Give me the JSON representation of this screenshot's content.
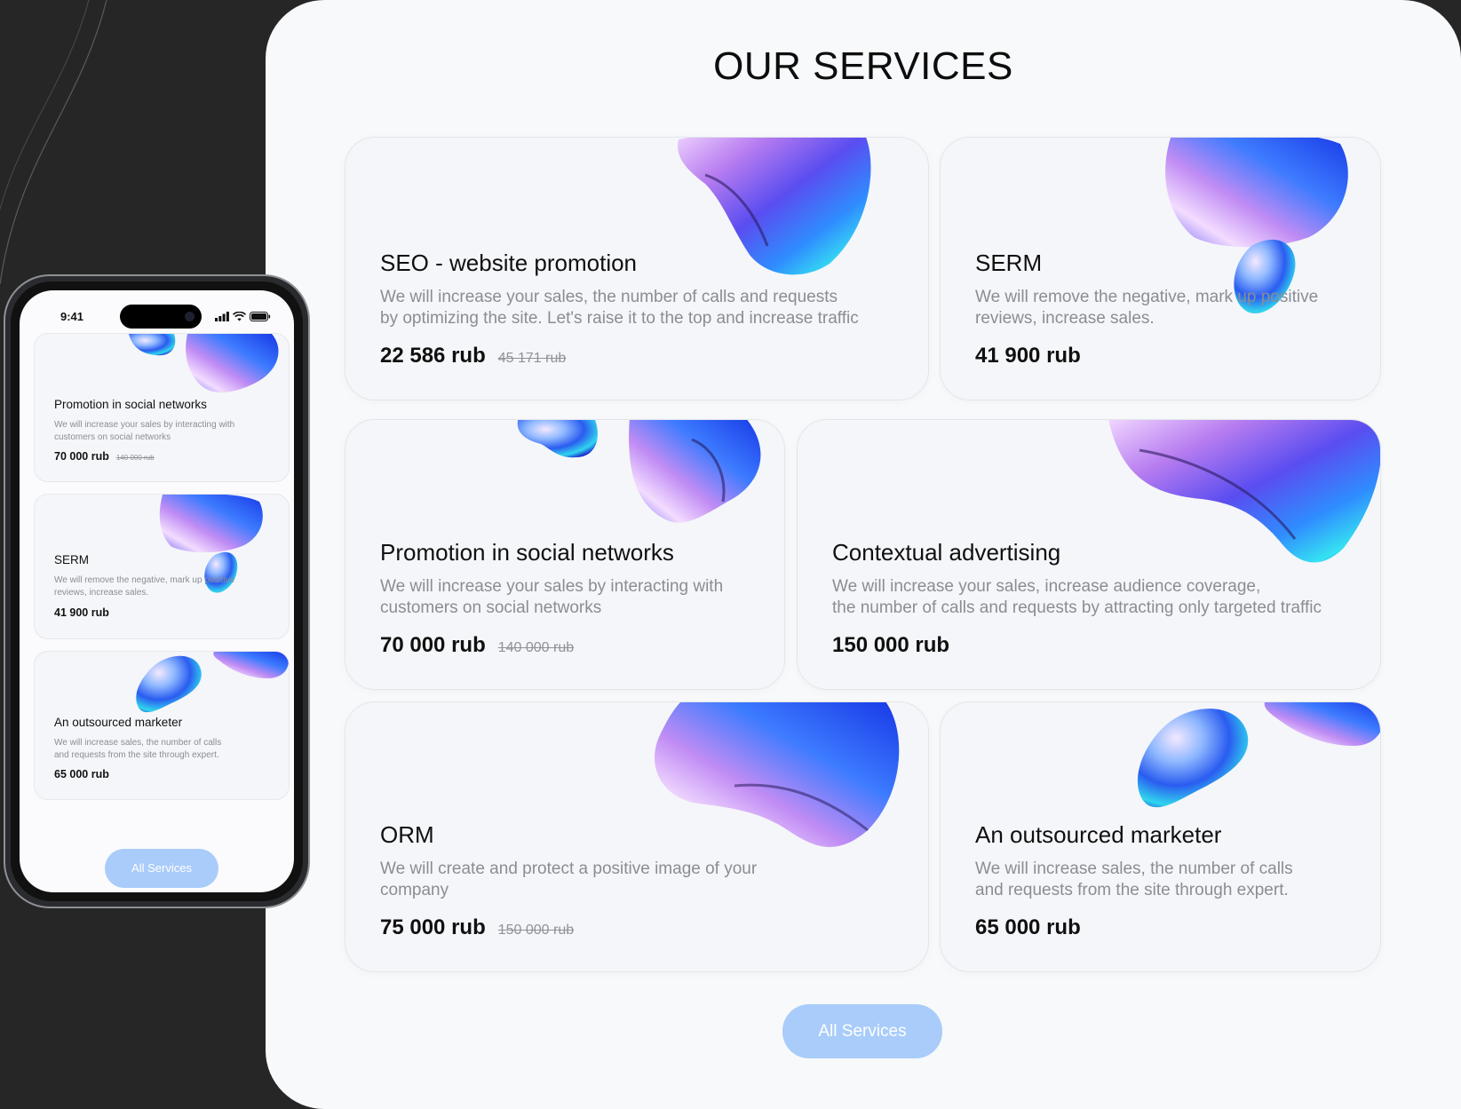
{
  "page": {
    "title": "OUR SERVICES"
  },
  "services": [
    {
      "title": "SEO - website promotion",
      "description_lines": [
        "We will increase your sales, the number of calls and requests",
        "by optimizing the site. Let's raise it to the top and increase traffic"
      ],
      "price": "22 586 rub",
      "old_price": "45 171 rub"
    },
    {
      "title": "SERM",
      "description_lines": [
        "We will remove the negative, mark up positive",
        "reviews, increase sales."
      ],
      "price": "41 900  rub",
      "old_price": ""
    },
    {
      "title": "Promotion in social networks",
      "description_lines": [
        "We will increase your sales by interacting with",
        "customers on social networks"
      ],
      "price": "70 000  rub",
      "old_price": "140 000 rub"
    },
    {
      "title": "Contextual advertising",
      "description_lines": [
        "We will increase your sales, increase audience coverage,",
        "the number of calls and requests by attracting only targeted traffic"
      ],
      "price": "150 000 rub",
      "old_price": ""
    },
    {
      "title": "ORM",
      "description_lines": [
        "We will create and protect a positive image of your",
        "company"
      ],
      "price": "75 000 rub",
      "old_price": "150 000 rub"
    },
    {
      "title": "An outsourced marketer",
      "description_lines": [
        "We will increase sales, the number of calls",
        "and requests from the site through expert."
      ],
      "price": "65 000  rub",
      "old_price": ""
    }
  ],
  "all_services_label": "All Services",
  "mobile": {
    "status_time": "9:41",
    "cards": [
      {
        "title": "Promotion in social networks",
        "description_lines": [
          "We will increase your sales by interacting with",
          "customers on social networks"
        ],
        "price": "70 000  rub",
        "old_price": "140 000 rub"
      },
      {
        "title": "SERM",
        "description_lines": [
          "We will remove the negative, mark up positive",
          "reviews, increase sales."
        ],
        "price": "41 900  rub",
        "old_price": ""
      },
      {
        "title": "An outsourced marketer",
        "description_lines": [
          "We will increase sales, the number of calls",
          "and requests from the site through expert."
        ],
        "price": "65 000  rub",
        "old_price": ""
      }
    ],
    "all_services_label": "All Services"
  },
  "icons": [
    "signal-icon",
    "wifi-icon",
    "battery-icon"
  ],
  "colors": {
    "accent_button": "#a9ccfa",
    "background_dark": "#262626",
    "panel": "#f8f9fb"
  }
}
